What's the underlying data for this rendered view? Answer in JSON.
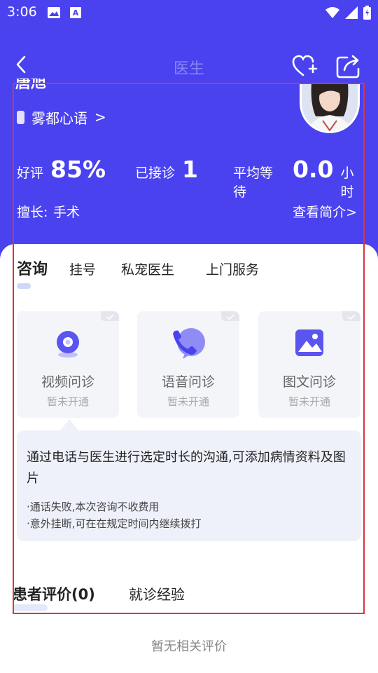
{
  "status_bar": {
    "time": "3:06",
    "left_icons": [
      "image-icon",
      "font-icon"
    ],
    "right_icons": [
      "wifi-icon",
      "signal-icon",
      "battery-icon"
    ]
  },
  "header": {
    "title": "医生",
    "back_icon": "chevron-left-icon",
    "favorite_icon": "heart-plus-icon",
    "share_icon": "share-icon"
  },
  "doctor": {
    "name_partial": "唐旭",
    "hospital": "雾都心语",
    "hospital_chevron": ">",
    "avatar": "doctor-avatar",
    "stats": {
      "rating_label": "好评",
      "rating_value": "85%",
      "consults_label": "已接诊",
      "consults_value": "1",
      "wait_label": "平均等待",
      "wait_value": "0.0",
      "wait_unit": "小时"
    },
    "specialty_label": "擅长:",
    "specialty_value": "手术",
    "intro_link": "查看简介>"
  },
  "tabs": [
    {
      "label": "咨询",
      "active": true
    },
    {
      "label": "挂号",
      "active": false
    },
    {
      "label": "私宠医生",
      "active": false
    },
    {
      "label": "上门服务",
      "active": false
    }
  ],
  "services": [
    {
      "name": "视频问诊",
      "status": "暂未开通",
      "icon": "video-camera-icon"
    },
    {
      "name": "语音问诊",
      "status": "暂未开通",
      "icon": "phone-chat-icon"
    },
    {
      "name": "图文问诊",
      "status": "暂未开通",
      "icon": "image-icon"
    }
  ],
  "info": {
    "description": "通过电话与医生进行选定时长的沟通,可添加病情资料及图片",
    "notes": [
      "·通话失败,本次咨询不收费用",
      "·意外挂断,可在在规定时间内继续拨打"
    ]
  },
  "review_tabs": [
    {
      "label": "患者评价(0)",
      "active": true
    },
    {
      "label": "就诊经验",
      "active": false
    }
  ],
  "empty_reviews": "暂无相关评价",
  "colors": {
    "brand": "#4a42ef",
    "selection": "#d9363e",
    "info_bg": "#eef1fa"
  }
}
